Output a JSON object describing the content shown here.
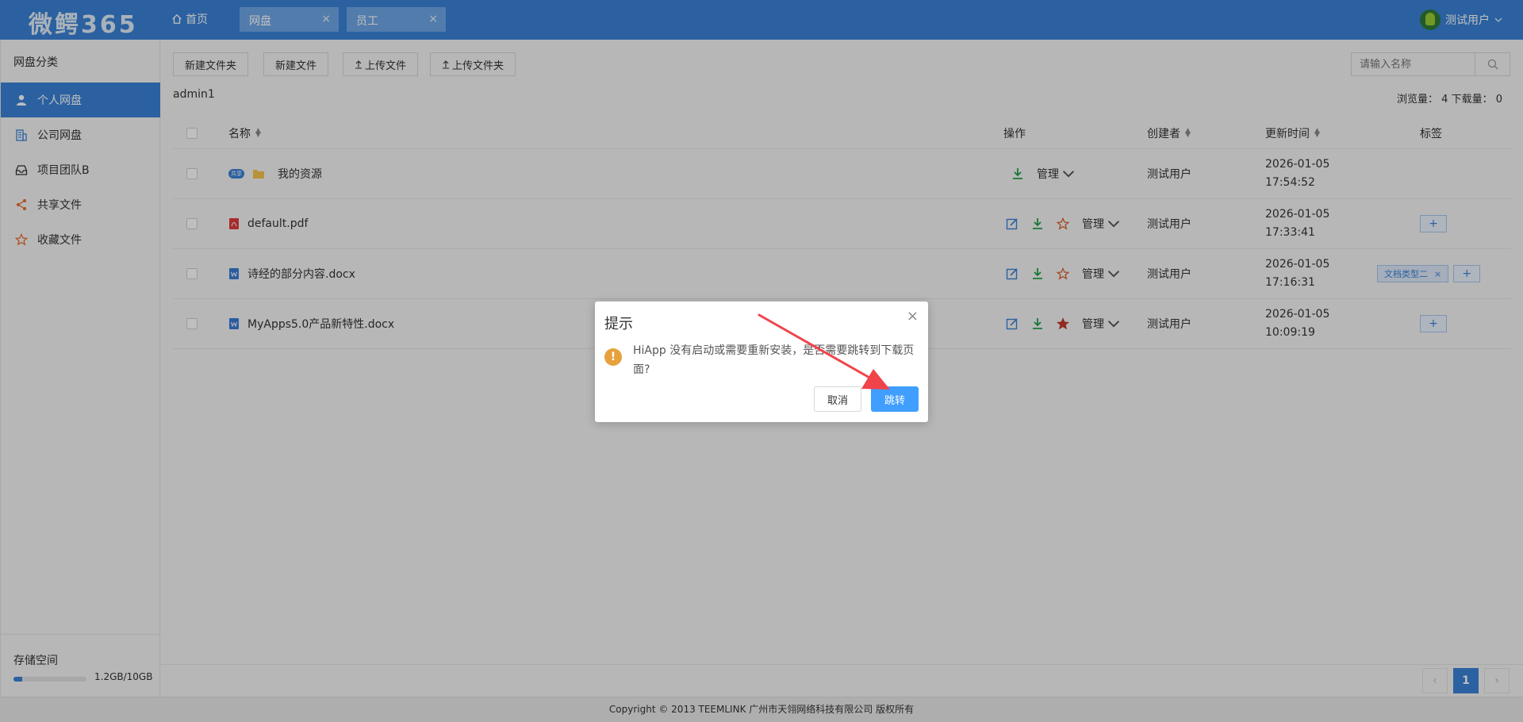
{
  "header": {
    "logo": "微鳄365",
    "home": "首页",
    "tabs": [
      {
        "label": "网盘",
        "close": "×"
      },
      {
        "label": "员工",
        "close": "×"
      }
    ],
    "user": "测试用户"
  },
  "sidebar": {
    "title": "网盘分类",
    "items": [
      {
        "label": "个人网盘",
        "icon": "user-icon"
      },
      {
        "label": "公司网盘",
        "icon": "building-icon"
      },
      {
        "label": "项目团队B",
        "icon": "inbox-icon"
      },
      {
        "label": "共享文件",
        "icon": "share-icon"
      },
      {
        "label": "收藏文件",
        "icon": "star-icon"
      }
    ],
    "storage": {
      "title": "存储空间",
      "used_fraction": 0.12,
      "text": "1.2GB/10GB"
    }
  },
  "toolbar": {
    "new_folder": "新建文件夹",
    "new_file": "新建文件",
    "upload_file": "上传文件",
    "upload_folder": "上传文件夹",
    "search_placeholder": "请输入名称"
  },
  "crumb": "admin1",
  "stats": "浏览量： 4   下载量： 0",
  "table": {
    "headers": {
      "name": "名称",
      "ops": "操作",
      "creator": "创建者",
      "updated": "更新时间",
      "tags": "标签"
    },
    "manage_label": "管理",
    "rows": [
      {
        "name": "我的资源",
        "type": "folder",
        "badge": "共享",
        "creator": "测试用户",
        "date": "2026-01-05",
        "time": "17:54:52",
        "tags": []
      },
      {
        "name": "default.pdf",
        "type": "pdf",
        "creator": "测试用户",
        "date": "2026-01-05",
        "time": "17:33:41",
        "tags": []
      },
      {
        "name": "诗经的部分内容.docx",
        "type": "docx",
        "creator": "测试用户",
        "date": "2026-01-05",
        "time": "17:16:31",
        "tags": [
          "文档类型二"
        ]
      },
      {
        "name": "MyApps5.0产品新特性.docx",
        "type": "docx",
        "creator": "测试用户",
        "date": "2026-01-05",
        "time": "10:09:19",
        "tags": []
      }
    ]
  },
  "pagination": {
    "prev": "‹",
    "current": "1",
    "next": "›"
  },
  "footer": "Copyright © 2013 TEEMLINK 广州市天翎网络科技有限公司 版权所有",
  "dialog": {
    "title": "提示",
    "close": "×",
    "message": "HiApp 没有启动或需要重新安装，是否需要跳转到下载页面?",
    "cancel": "取消",
    "confirm": "跳转"
  },
  "colors": {
    "primary": "#3a82d6",
    "confirm": "#409eff",
    "warning": "#e6a23c",
    "arrow": "#f0444a"
  }
}
